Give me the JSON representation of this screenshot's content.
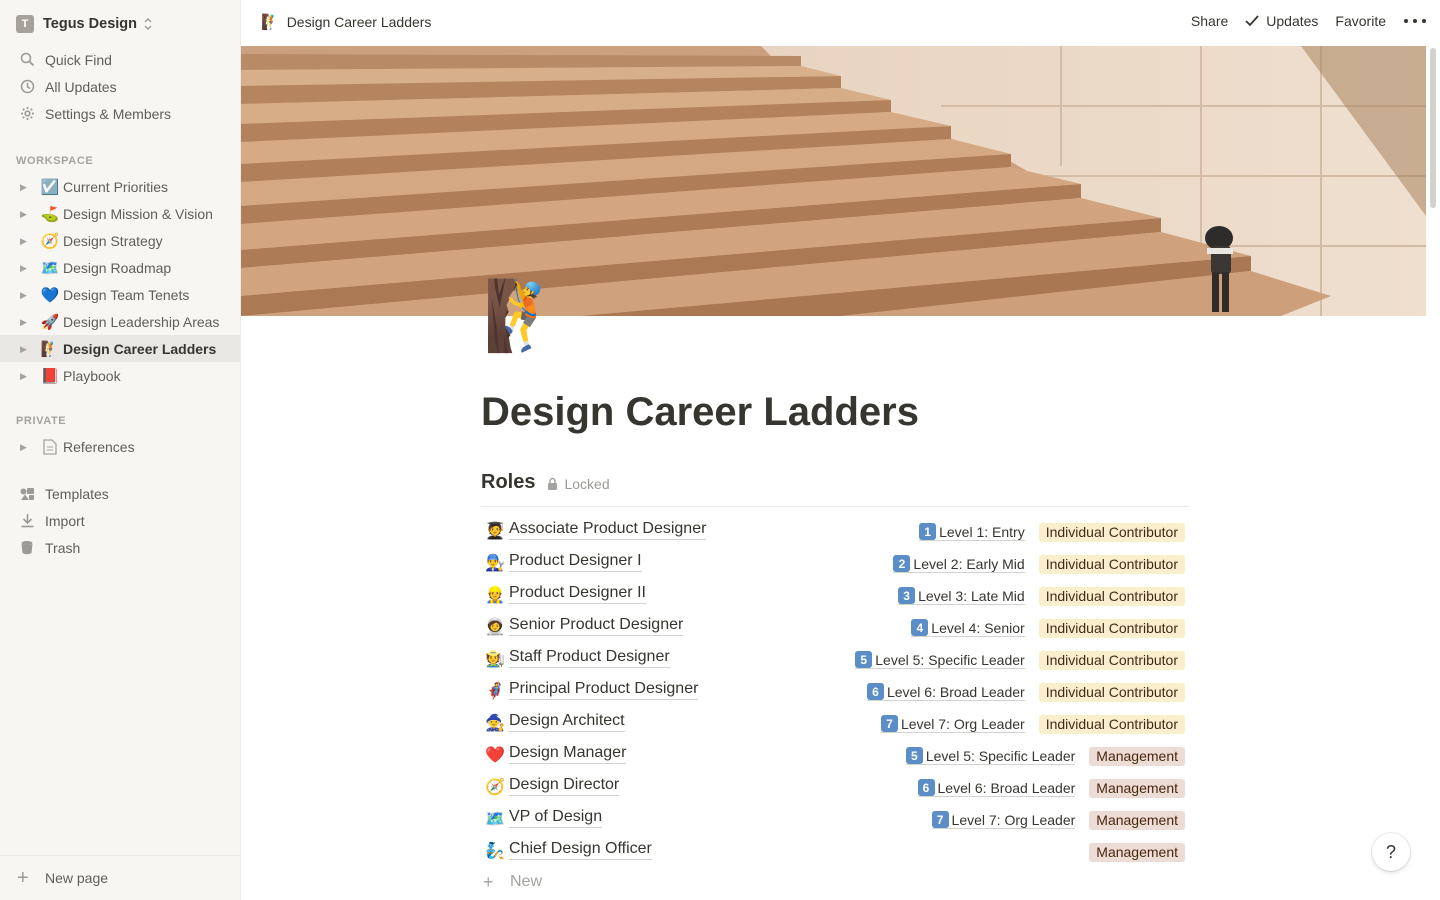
{
  "sidebar": {
    "workspace": {
      "avatar": "T",
      "name": "Tegus Design"
    },
    "top_items": [
      {
        "label": "Quick Find",
        "icon": "search-icon"
      },
      {
        "label": "All Updates",
        "icon": "clock-icon"
      },
      {
        "label": "Settings & Members",
        "icon": "gear-icon"
      }
    ],
    "workspace_section": "WORKSPACE",
    "pages": [
      {
        "emoji": "☑️",
        "label": "Current Priorities"
      },
      {
        "emoji": "⛳",
        "label": "Design Mission & Vision"
      },
      {
        "emoji": "🧭",
        "label": "Design Strategy"
      },
      {
        "emoji": "🗺️",
        "label": "Design Roadmap"
      },
      {
        "emoji": "💙",
        "label": "Design Team Tenets"
      },
      {
        "emoji": "🚀",
        "label": "Design Leadership Areas"
      },
      {
        "emoji": "🧗",
        "label": "Design Career Ladders"
      },
      {
        "emoji": "📕",
        "label": "Playbook"
      }
    ],
    "private_section": "PRIVATE",
    "private_pages": [
      {
        "emoji": "📄",
        "label": "References"
      }
    ],
    "bottom_items": [
      {
        "label": "Templates",
        "icon": "templates-icon"
      },
      {
        "label": "Import",
        "icon": "import-icon"
      },
      {
        "label": "Trash",
        "icon": "trash-icon"
      }
    ],
    "new_page": "New page"
  },
  "topbar": {
    "breadcrumb_emoji": "🧗",
    "breadcrumb": "Design Career Ladders",
    "share": "Share",
    "updates": "Updates",
    "favorite": "Favorite"
  },
  "page": {
    "icon": "🧗",
    "title": "Design Career Ladders"
  },
  "database": {
    "title": "Roles",
    "locked": "Locked",
    "rows": [
      {
        "emoji": "🧑‍🎓",
        "name": "Associate Product Designer",
        "level_num": "1",
        "level": "Level 1: Entry",
        "tag": "Individual Contributor",
        "tag_type": "ic"
      },
      {
        "emoji": "👨‍🔧",
        "name": "Product Designer I",
        "level_num": "2",
        "level": "Level 2: Early Mid",
        "tag": "Individual Contributor",
        "tag_type": "ic"
      },
      {
        "emoji": "👷",
        "name": "Product Designer II",
        "level_num": "3",
        "level": "Level 3: Late Mid",
        "tag": "Individual Contributor",
        "tag_type": "ic"
      },
      {
        "emoji": "🧑‍🚀",
        "name": "Senior Product Designer",
        "level_num": "4",
        "level": "Level 4: Senior",
        "tag": "Individual Contributor",
        "tag_type": "ic"
      },
      {
        "emoji": "🧑‍🌾",
        "name": "Staff Product Designer",
        "level_num": "5",
        "level": "Level 5: Specific Leader",
        "tag": "Individual Contributor",
        "tag_type": "ic"
      },
      {
        "emoji": "🦸",
        "name": "Principal Product Designer",
        "level_num": "6",
        "level": "Level 6: Broad Leader",
        "tag": "Individual Contributor",
        "tag_type": "ic"
      },
      {
        "emoji": "🧙",
        "name": "Design Architect",
        "level_num": "7",
        "level": "Level 7: Org Leader",
        "tag": "Individual Contributor",
        "tag_type": "ic"
      },
      {
        "emoji": "❤️",
        "name": "Design Manager",
        "level_num": "5",
        "level": "Level 5: Specific Leader",
        "tag": "Management",
        "tag_type": "mg"
      },
      {
        "emoji": "🧭",
        "name": "Design Director",
        "level_num": "6",
        "level": "Level 6: Broad Leader",
        "tag": "Management",
        "tag_type": "mg"
      },
      {
        "emoji": "🗺️",
        "name": "VP of Design",
        "level_num": "7",
        "level": "Level 7: Org Leader",
        "tag": "Management",
        "tag_type": "mg"
      },
      {
        "emoji": "🧞",
        "name": "Chief Design Officer",
        "level_num": "",
        "level": "",
        "tag": "Management",
        "tag_type": "mg"
      }
    ],
    "new_label": "New"
  },
  "help": "?"
}
